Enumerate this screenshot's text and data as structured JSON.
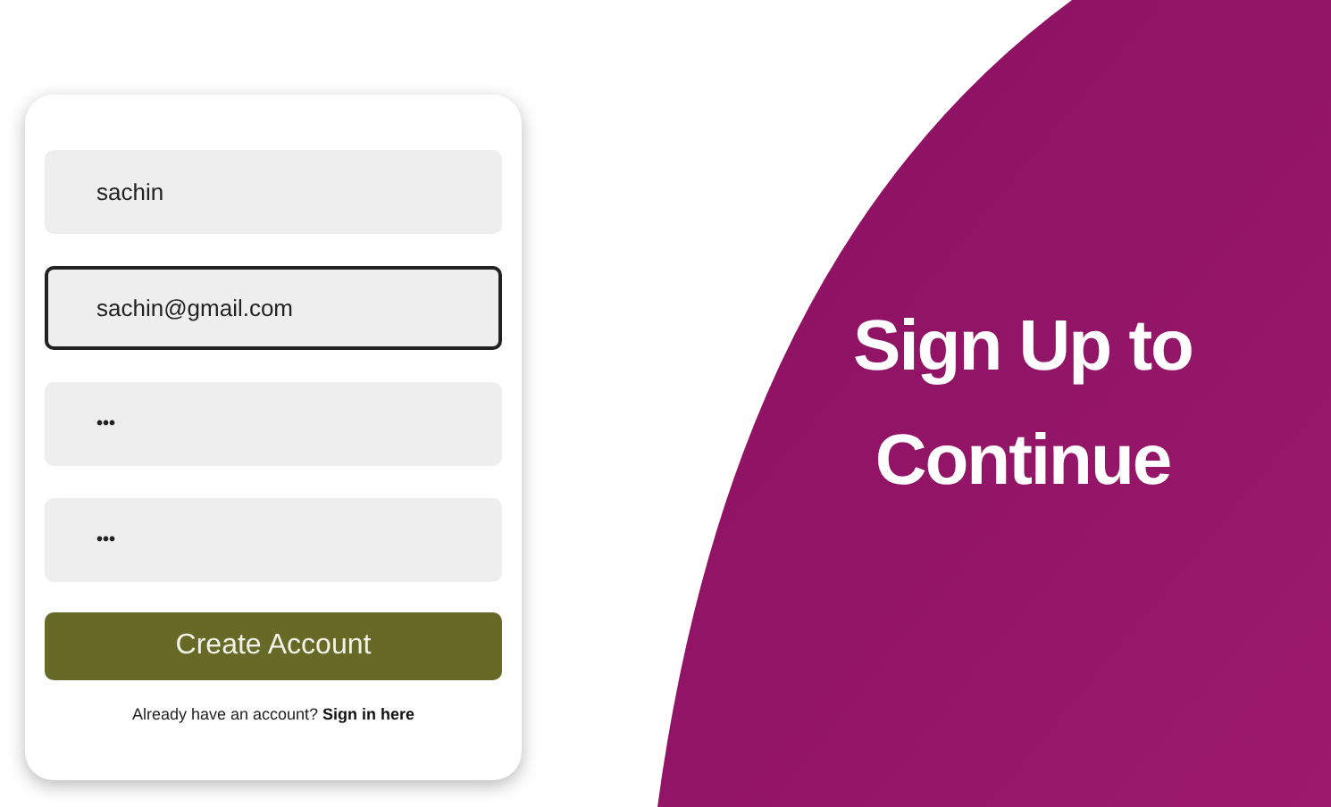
{
  "form": {
    "fields": [
      {
        "kind": "text",
        "value": "sachin",
        "focused": false
      },
      {
        "kind": "email",
        "value": "sachin@gmail.com",
        "focused": true
      },
      {
        "kind": "password",
        "value": "•••",
        "focused": false
      },
      {
        "kind": "password",
        "value": "•••",
        "focused": false
      }
    ],
    "submit": "Create Account",
    "prompt": "Already have an account?",
    "link": "Sign in here"
  },
  "banner": {
    "title_lines": [
      "Sign Up to",
      "Continue"
    ]
  }
}
